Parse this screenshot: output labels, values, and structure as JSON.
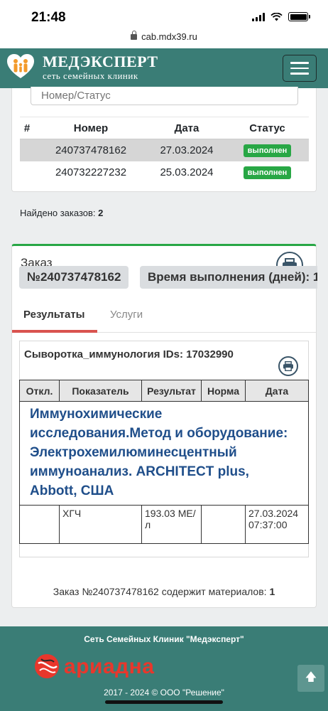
{
  "status_bar": {
    "time": "21:48"
  },
  "browser": {
    "url": "cab.mdx39.ru"
  },
  "navbar": {
    "brand_name": "МЕДЭКСПЕРТ",
    "brand_sub": "сеть семейных клиник",
    "menu_icon": "hamburger-icon"
  },
  "orders": {
    "search_placeholder": "Номер/Статус",
    "columns": [
      "#",
      "Номер",
      "Дата",
      "Статус"
    ],
    "rows": [
      {
        "number": "240737478162",
        "date": "27.03.2024",
        "status": "выполнен",
        "selected": true
      },
      {
        "number": "240732227232",
        "date": "25.03.2024",
        "status": "выполнен",
        "selected": false
      }
    ],
    "found_label": "Найдено заказов:",
    "found_count": "2"
  },
  "order": {
    "heading": "Заказ",
    "number": "№240737478162",
    "time_label": "Время выполнения (дней): 1",
    "tabs": {
      "results": "Результаты",
      "services": "Услуги"
    },
    "result_block": {
      "title": "Сыворотка_иммунология IDs: 17032990",
      "columns": [
        "Откл.",
        "Показатель",
        "Результат",
        "Норма",
        "Дата"
      ],
      "method": "Иммунохимические исследования.Метод и оборудование: Электрохемилюминесцентный иммуноанализ. ARCHITECT plus, Abbott, США",
      "rows": [
        {
          "deviation": "",
          "indicator": "ХГЧ",
          "result": "193.03 МЕ/л",
          "norm": "",
          "date": "27.03.2024 07:37:00"
        }
      ]
    },
    "materials_text": "Заказ №240737478162 содержит материалов:",
    "materials_count": "1"
  },
  "footer": {
    "title": "Сеть Семейных Клиник \"Медэксперт\"",
    "partner_logo": "ариадна",
    "copyright": "2017 - 2024 © ООО \"Решение\""
  },
  "colors": {
    "brand": "#3a7d76",
    "success": "#28a745",
    "tab_accent": "#d9534f",
    "method_text": "#1f4e8a",
    "partner": "#e8372c"
  }
}
